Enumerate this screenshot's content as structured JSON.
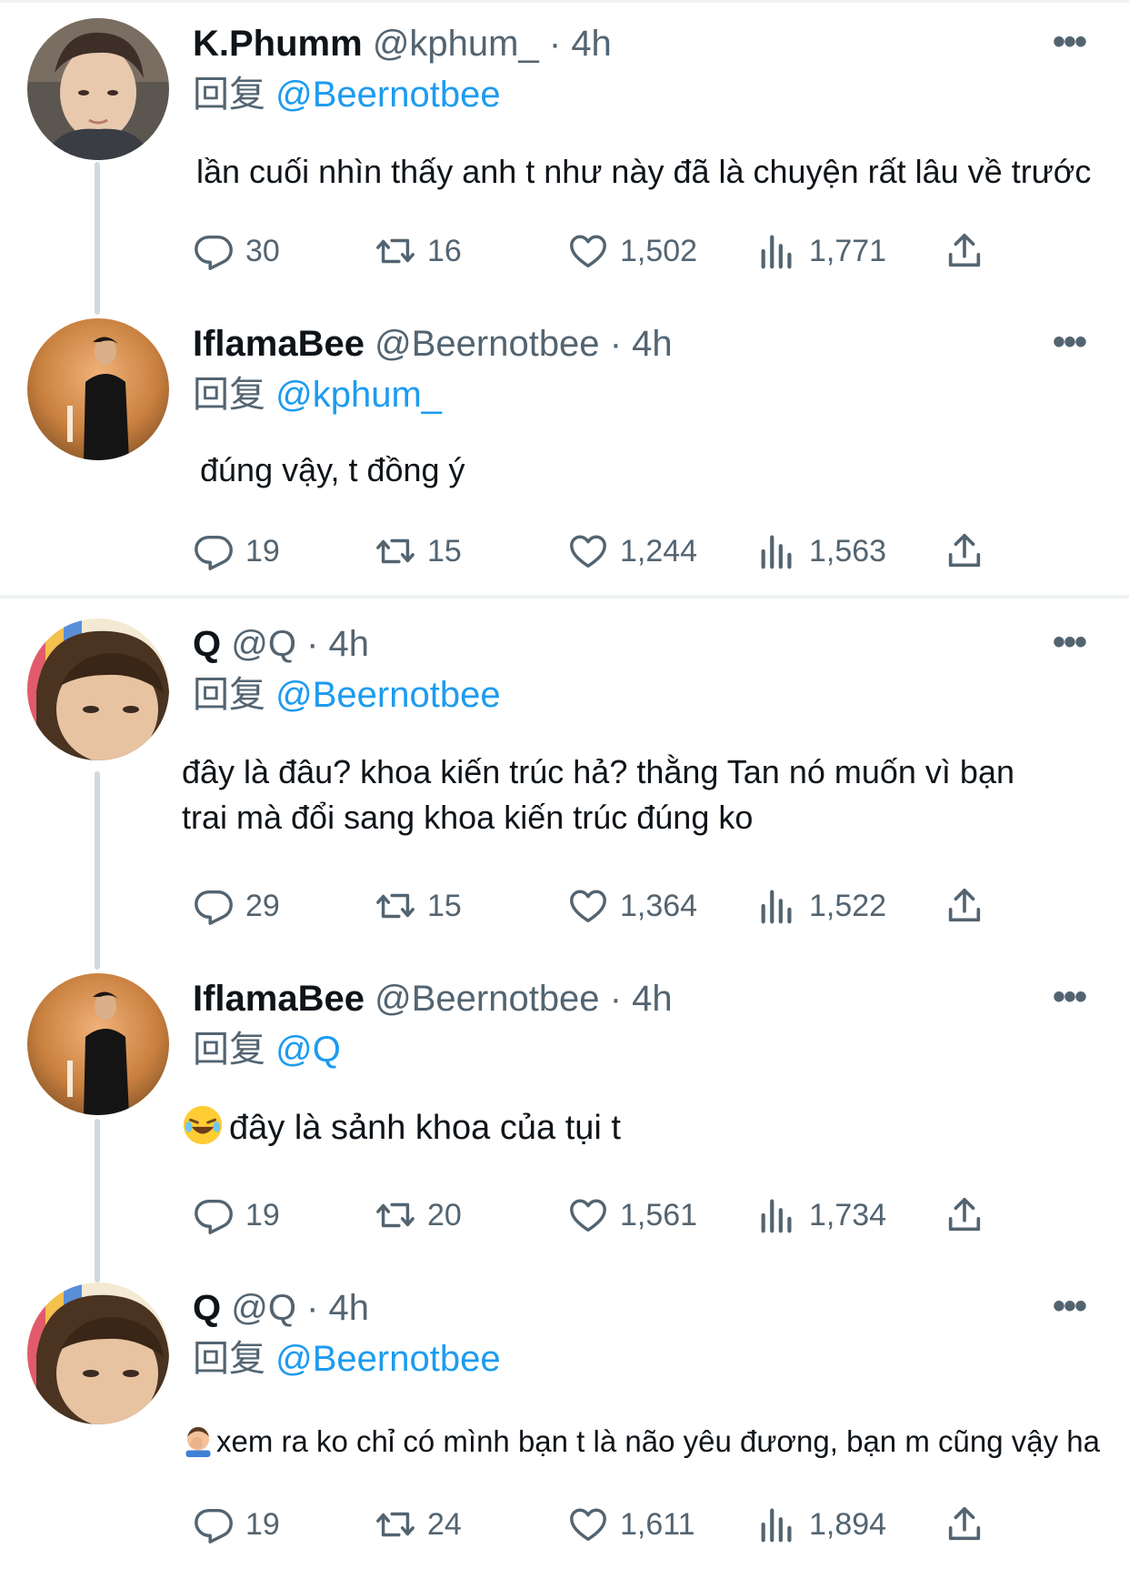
{
  "ui": {
    "more_glyph": "•••",
    "dot": "·",
    "reply_prefix": "回复",
    "colors": {
      "link": "#1d9bf0",
      "meta": "#536471",
      "text": "#0f1419",
      "divider": "#eff3f4",
      "thread": "#cfd9de"
    },
    "icons": [
      "reply-icon",
      "retweet-icon",
      "like-icon",
      "views-icon",
      "share-icon",
      "more-icon",
      "laughing-emoji",
      "facepalm-emoji"
    ]
  },
  "tweets": [
    {
      "name": "K.Phumm",
      "handle": "@kphum_",
      "time": "4h",
      "reply_to": "@Beernotbee",
      "text": "lần cuối nhìn thấy anh t như này đã là chuyện rất lâu về trước",
      "replies": "30",
      "retweets": "16",
      "likes": "1,502",
      "views": "1,771"
    },
    {
      "name": "IflamaBee",
      "handle": "@Beernotbee",
      "time": "4h",
      "reply_to": "@kphum_",
      "text": "đúng vậy, t đồng ý",
      "replies": "19",
      "retweets": "15",
      "likes": "1,244",
      "views": "1,563"
    },
    {
      "name": "Q",
      "handle": "@Q",
      "time": "4h",
      "reply_to": "@Beernotbee",
      "text_line1": "đây là đâu? khoa kiến trúc hả? thằng Tan nó muốn vì bạn",
      "text_line2": "trai mà đổi sang khoa kiến trúc đúng ko",
      "replies": "29",
      "retweets": "15",
      "likes": "1,364",
      "views": "1,522"
    },
    {
      "name": "IflamaBee",
      "handle": "@Beernotbee",
      "time": "4h",
      "reply_to": "@Q",
      "text": "đây là sảnh khoa của tụi t",
      "replies": "19",
      "retweets": "20",
      "likes": "1,561",
      "views": "1,734"
    },
    {
      "name": "Q",
      "handle": "@Q",
      "time": "4h",
      "reply_to": "@Beernotbee",
      "text": "xem ra ko chỉ có mình bạn t là não yêu đương, bạn m cũng vậy ha",
      "replies": "19",
      "retweets": "24",
      "likes": "1,611",
      "views": "1,894"
    }
  ]
}
